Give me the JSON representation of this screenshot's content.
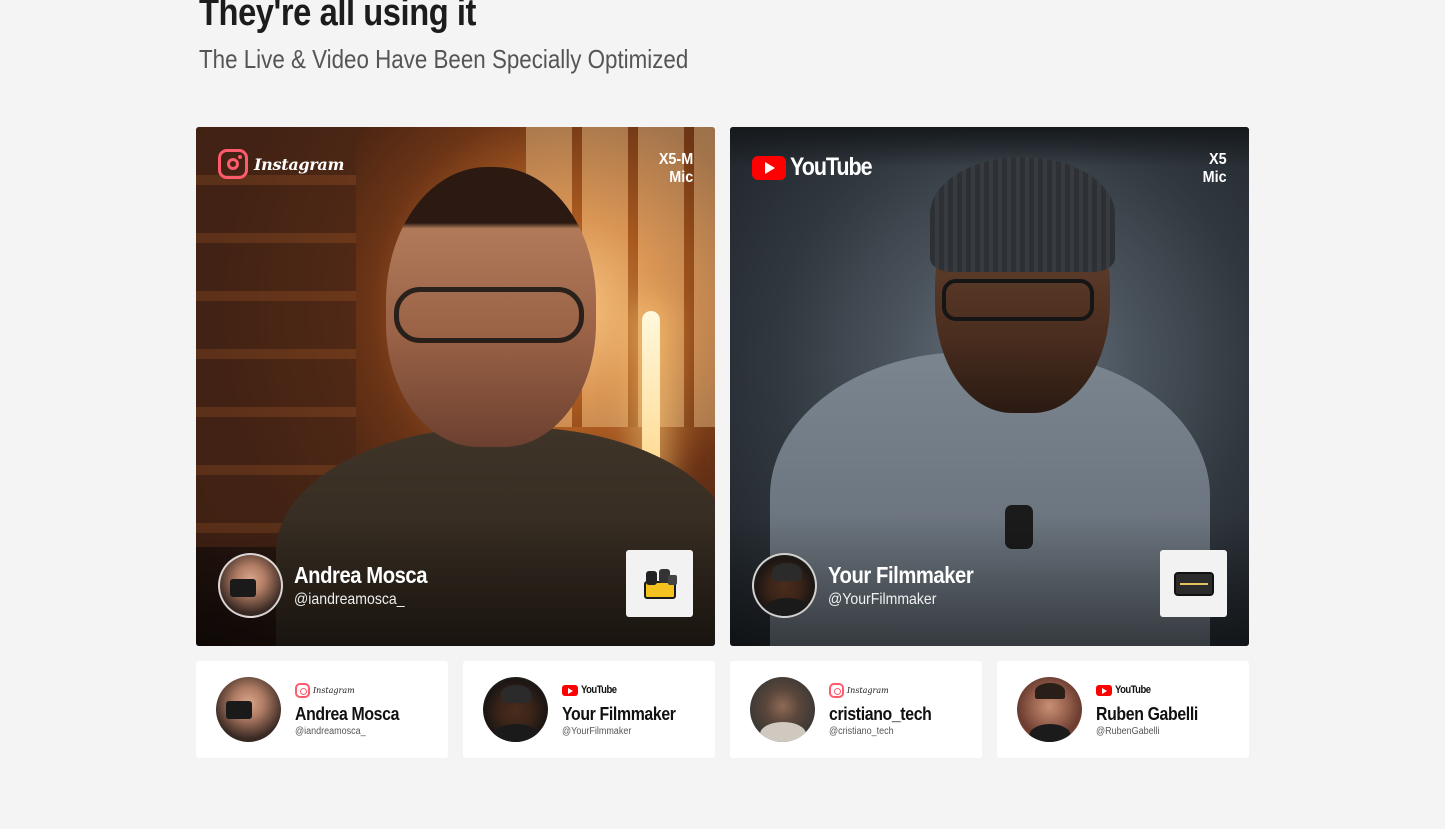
{
  "section": {
    "title": "They're all using it",
    "subtitle": "The Live & Video Have Been Specially Optimized"
  },
  "featured": [
    {
      "platform": "Instagram",
      "platform_icon": "instagram-icon",
      "product_line1": "X5-M",
      "product_line2": "Mic",
      "name": "Andrea Mosca",
      "handle": "@iandreamosca_",
      "product_icon": "charging-case-icon"
    },
    {
      "platform": "YouTube",
      "platform_icon": "youtube-icon",
      "product_line1": "X5",
      "product_line2": "Mic",
      "name": "Your Filmmaker",
      "handle": "@YourFilmmaker",
      "product_icon": "receiver-icon"
    }
  ],
  "creators": [
    {
      "platform": "Instagram",
      "platform_icon": "instagram-icon",
      "name": "Andrea Mosca",
      "handle": "@iandreamosca_"
    },
    {
      "platform": "YouTube",
      "platform_icon": "youtube-icon",
      "name": "Your Filmmaker",
      "handle": "@YourFilmmaker"
    },
    {
      "platform": "Instagram",
      "platform_icon": "instagram-icon",
      "name": "cristiano_tech",
      "handle": "@cristiano_tech"
    },
    {
      "platform": "YouTube",
      "platform_icon": "youtube-icon",
      "name": "Ruben Gabelli",
      "handle": "@RubenGabelli"
    }
  ],
  "colors": {
    "background": "#f4f4f4",
    "instagram_accent": "#ff5b6c",
    "youtube_red": "#ff0000"
  }
}
